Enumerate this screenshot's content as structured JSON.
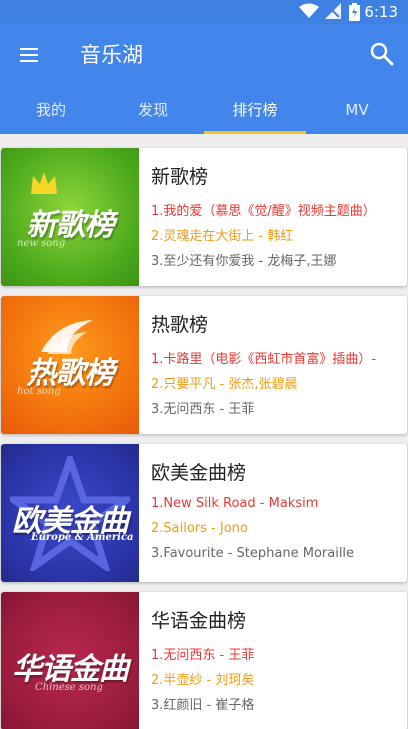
{
  "status": {
    "time": "6:13"
  },
  "appbar": {
    "title": "音乐湖"
  },
  "tabs": [
    {
      "label": "我的"
    },
    {
      "label": "发现"
    },
    {
      "label": "排行榜"
    },
    {
      "label": "MV"
    }
  ],
  "active_tab": "排行榜",
  "colors": {
    "primary": "#4286ec",
    "indicator": "#f5c518",
    "rank1": "#e53935",
    "rank2": "#f29b13",
    "rank3": "#666666"
  },
  "charts": [
    {
      "name": "新歌榜",
      "cover_text": "新歌榜",
      "cover_sub": "new song",
      "songs": [
        "1.我的爱（慕思《觉/醒》视频主题曲）",
        "2.灵魂走在大街上 - 韩红",
        "3.至少还有你爱我 - 龙梅子,王娜"
      ]
    },
    {
      "name": "热歌榜",
      "cover_text": "热歌榜",
      "cover_sub": "hot song",
      "songs": [
        "1.卡路里（电影《西虹市首富》插曲）-",
        "2.只要平凡 - 张杰,张碧晨",
        "3.无问西东 - 王菲"
      ]
    },
    {
      "name": "欧美金曲榜",
      "cover_text": "欧美金曲",
      "cover_sub": "Europe & America",
      "songs": [
        "1.New Silk Road - Maksim",
        "2.Sailors - Jono",
        "3.Favourite - Stephane Moraille"
      ]
    },
    {
      "name": "华语金曲榜",
      "cover_text": "华语金曲",
      "cover_sub": "Chinese song",
      "songs": [
        "1.无问西东 - 王菲",
        "2.半壶纱 - 刘珂矣",
        "3.红颜旧 - 崔子格"
      ]
    }
  ]
}
